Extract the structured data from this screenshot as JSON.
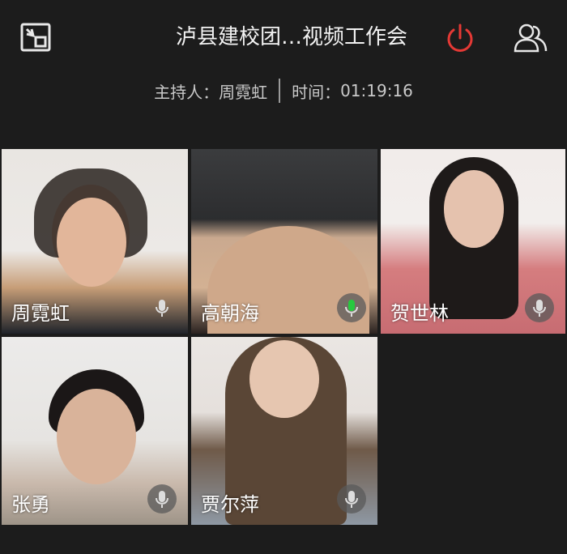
{
  "header": {
    "title": "泸县建校团…视频工作会",
    "host_label": "主持人：",
    "host_name": "周霓虹",
    "time_label": "时间：",
    "time_value": "01:19:16"
  },
  "icons": {
    "minimize": "minimize-window-icon",
    "power": "power-icon",
    "people": "participants-icon",
    "mic": "microphone-icon"
  },
  "colors": {
    "background": "#1c1c1c",
    "power_accent": "#e53935",
    "speaking_green": "#27c93f"
  },
  "participants": [
    {
      "name": "周霓虹"
    },
    {
      "name": "高朝海"
    },
    {
      "name": "贺世林"
    },
    {
      "name": "张勇"
    },
    {
      "name": "贾尔萍"
    }
  ]
}
